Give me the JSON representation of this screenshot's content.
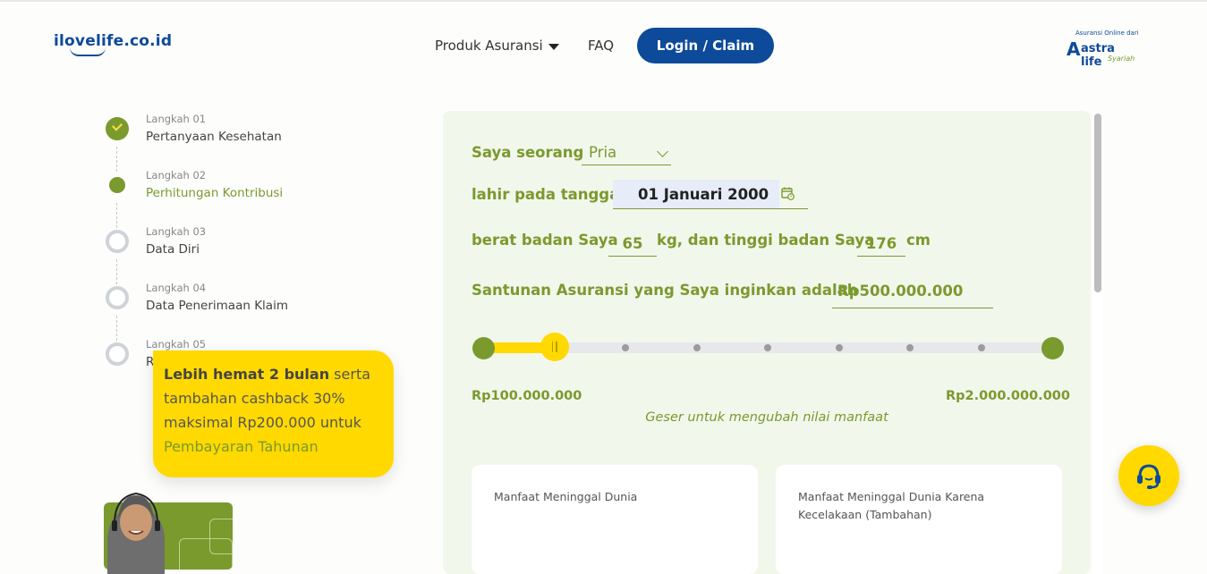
{
  "header": {
    "logo": "ilovelife.co.id",
    "nav_produk": "Produk Asuransi",
    "nav_faq": "FAQ",
    "login_label": "Login / Claim",
    "brand": {
      "tagline": "Asuransi Online dari",
      "name": "astra life",
      "sub": "Syariah"
    }
  },
  "steps": [
    {
      "small": "Langkah 01",
      "title": "Pertanyaan Kesehatan",
      "state": "done"
    },
    {
      "small": "Langkah 02",
      "title": "Perhitungan Kontribusi",
      "state": "active"
    },
    {
      "small": "Langkah 03",
      "title": "Data Diri",
      "state": "pending"
    },
    {
      "small": "Langkah 04",
      "title": "Data Penerimaan Klaim",
      "state": "pending"
    },
    {
      "small": "Langkah 05",
      "title": "Ri",
      "state": "pending"
    }
  ],
  "promo": {
    "bold": "Lebih hemat 2 bulan",
    "text": " serta tambahan cashback 30% maksimal Rp200.000 untuk ",
    "highlight": "Pembayaran Tahunan"
  },
  "form": {
    "q_gender": "Saya seorang",
    "gender_value": "Pria",
    "q_birth": "lahir pada tanggal",
    "birth_value": "01 Januari 2000",
    "q_weight": "berat badan Saya",
    "weight_value": "65",
    "q_height": "kg, dan tinggi badan Saya",
    "height_value": "176",
    "height_unit": "cm",
    "q_sum": "Santunan Asuransi yang Saya inginkan adalah",
    "sum_value": "Rp500.000.000"
  },
  "slider": {
    "min_label": "Rp100.000.000",
    "max_label": "Rp2.000.000.000",
    "hint": "Geser untuk mengubah nilai manfaat",
    "steps": 9,
    "selected_index": 1,
    "fill_color": "#ffd900",
    "accent_color": "#7a9a2e"
  },
  "cards": [
    {
      "title": "Manfaat Meninggal Dunia"
    },
    {
      "title": "Manfaat Meninggal Dunia Karena Kecelakaan (Tambahan)"
    }
  ],
  "icons": {
    "calendar": "calendar-icon",
    "chat": "headset-icon",
    "dropdown": "chevron-down-icon"
  }
}
